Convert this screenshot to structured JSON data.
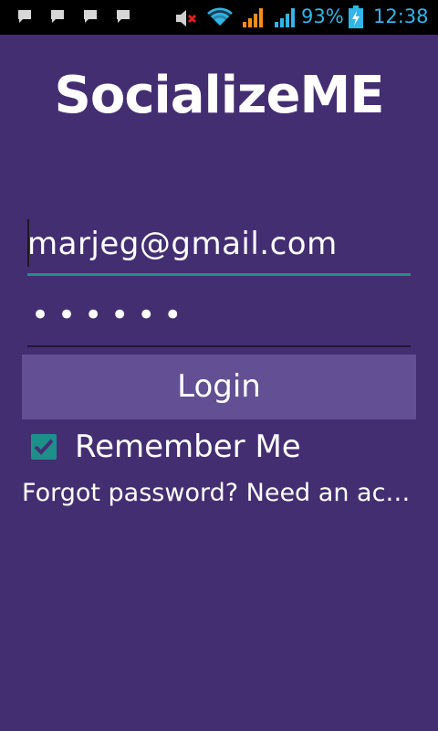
{
  "status_bar": {
    "notification_icons": [
      "chat-notification-icon",
      "chat-notification-icon",
      "chat-notification-icon",
      "chat-notification-icon"
    ],
    "mute_icon": "speaker-muted-icon",
    "wifi_icon": "wifi-icon",
    "signal_icons": [
      "signal-orange-icon",
      "signal-blue-icon"
    ],
    "battery_level": "93%",
    "battery_icon": "battery-charging-icon",
    "time": "12:38",
    "accent_color": "#33b5e5"
  },
  "app": {
    "title": "SocializeME",
    "background_color": "#442e72",
    "accent_color": "#1d9089"
  },
  "form": {
    "email_value": "marjeg@gmail.com",
    "password_value": "••••••",
    "login_label": "Login",
    "remember_label": "Remember Me",
    "remember_checked": true,
    "links_text": "Forgot password? Need an ac…"
  }
}
